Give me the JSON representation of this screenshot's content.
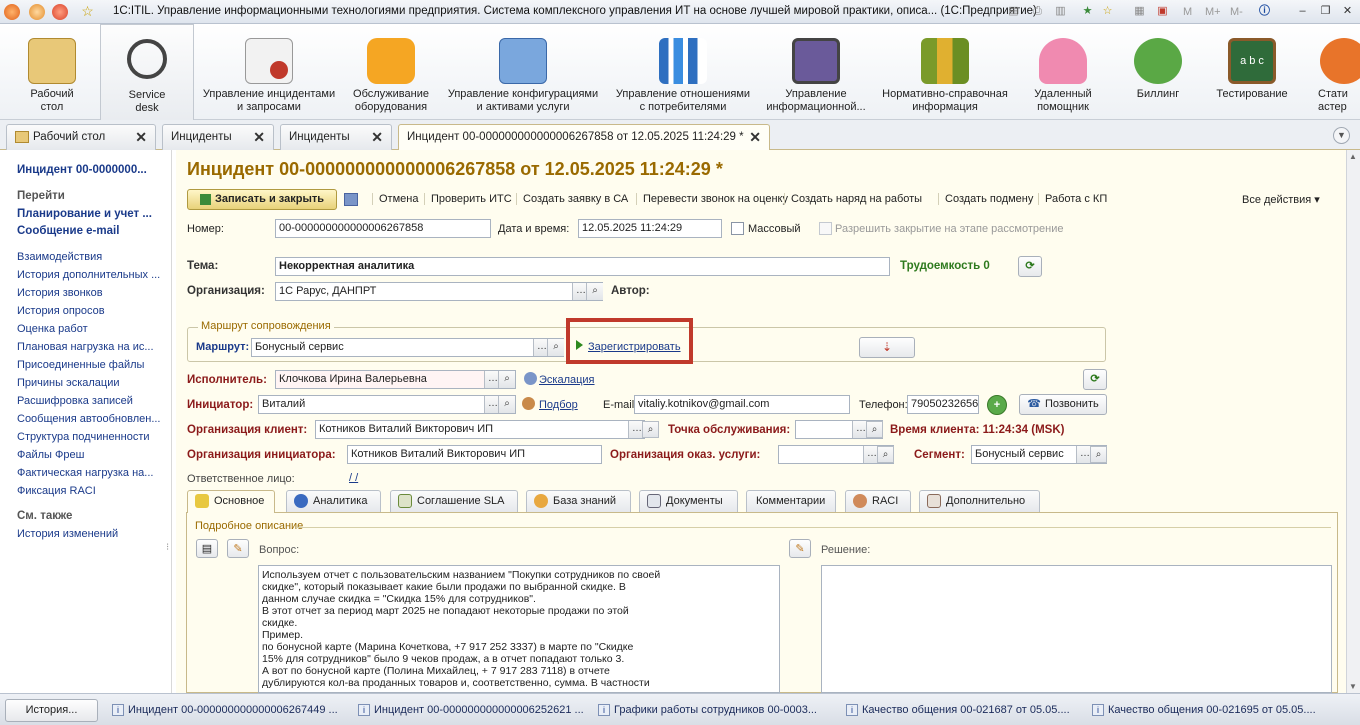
{
  "window": {
    "title": "1С:ITIL. Управление информационными технологиями предприятия. Система комплексного управления ИТ на основе лучшей мировой практики, описа...  (1С:Предприятие)",
    "toolbar_right": [
      "M",
      "M+",
      "M-"
    ]
  },
  "sections": [
    {
      "label": "Рабочий\nстол",
      "icon": "desk-icon",
      "color": "#c9a24a"
    },
    {
      "label": "Service\ndesk",
      "icon": "headset-icon",
      "color": "#333333"
    },
    {
      "label": "Управление инцидентами\nи запросами",
      "icon": "incident-doc-icon",
      "color": "#c0392b"
    },
    {
      "label": "Обслуживание\nоборудования",
      "icon": "truck-icon",
      "color": "#f39c12"
    },
    {
      "label": "Управление конфигурациями\nи активами услуги",
      "icon": "config-icon",
      "color": "#3a78c9"
    },
    {
      "label": "Управление отношениями\nс потребителями",
      "icon": "chart-bars-icon",
      "color": "#2e6fc0"
    },
    {
      "label": "Управление\nинформационной...",
      "icon": "lock-monitor-icon",
      "color": "#6a5a9a"
    },
    {
      "label": "Нормативно-справочная\nинформация",
      "icon": "binders-icon",
      "color": "#6b8e23"
    },
    {
      "label": "Удаленный\nпомощник",
      "icon": "patrick-icon",
      "color": "#e87aa0"
    },
    {
      "label": "Биллинг",
      "icon": "plankton-icon",
      "color": "#4f9a3a"
    },
    {
      "label": "Тестирование",
      "icon": "blackboard-icon",
      "color": "#2f6b3a"
    },
    {
      "label": "Стати\nастер",
      "icon": "stats-icon",
      "color": "#e8742a"
    }
  ],
  "open_tabs": [
    {
      "label": "Рабочий стол"
    },
    {
      "label": "Инциденты"
    },
    {
      "label": "Инциденты"
    },
    {
      "label": "Инцидент 00-000000000000006267858 от 12.05.2025 11:24:29 *"
    }
  ],
  "left_panel": {
    "header": "Инцидент 00-0000000...",
    "go_label": "Перейти",
    "bold_links": [
      "Планирование и учет ...",
      "Сообщение e-mail"
    ],
    "links": [
      "Взаимодействия",
      "История дополнительных ...",
      "История звонков",
      "История опросов",
      "Оценка работ",
      "Плановая нагрузка на ис...",
      "Присоединенные файлы",
      "Причины эскалации",
      "Расшифровка записей",
      "Сообщения автообновлен...",
      "Структура подчиненности",
      "Файлы Фреш",
      "Фактическая нагрузка на...",
      "Фиксация RACI"
    ],
    "see_also_label": "См. также",
    "see_also": [
      "История изменений"
    ]
  },
  "form": {
    "title": "Инцидент 00-000000000000006267858 от 12.05.2025 11:24:29 *",
    "toolbar": {
      "save_close": "Записать и закрыть",
      "items": [
        "Отмена",
        "Проверить ИТС",
        "Создать заявку в СА",
        "Перевести звонок на оценку",
        "Создать наряд на работы",
        "Создать подмену",
        "Работа с КП"
      ],
      "all_actions": "Все действия"
    },
    "number_label": "Номер:",
    "number": "00-000000000000006267858",
    "datetime_label": "Дата и время:",
    "datetime": "12.05.2025 11:24:29",
    "mass_label": "Массовый",
    "allow_close_label": "Разрешить закрытие на этапе рассмотрение",
    "subject_label": "Тема:",
    "subject": "Некорректная аналитика",
    "labor_label": "Трудоемкость 0",
    "org_label": "Организация:",
    "org": "1С Рарус, ДАНПРТ",
    "author_label": "Автор:",
    "route_group": "Маршрут сопровождения",
    "route_label": "Маршрут:",
    "route": "Бонусный сервис",
    "register_link": "Зарегистрировать",
    "executor_label": "Исполнитель:",
    "executor": "Клочкова Ирина Валерьевна",
    "escalation_link": "Эскалация",
    "initiator_label": "Инициатор:",
    "initiator": "Виталий",
    "select_link": "Подбор",
    "email_label": "E-mail:",
    "email": "vitaliy.kotnikov@gmail.com",
    "phone_label": "Телефон:",
    "phone": "79050232656",
    "call_button": "Позвонить",
    "client_org_label": "Организация клиент:",
    "client_org": "Котников Виталий Викторович ИП",
    "service_point_label": "Точка обслуживания:",
    "client_time_label": "Время клиента:  11:24:34 (MSK)",
    "init_org_label": "Организация инициатора:",
    "init_org": "Котников Виталий Викторович ИП",
    "provider_org_label": "Организация оказ. услуги:",
    "segment_label": "Сегмент:",
    "segment": "Бонусный сервис",
    "responsible_label": "Ответственное лицо:",
    "responsible": "/ /",
    "content_tabs": [
      "Основное",
      "Аналитика",
      "Соглашение SLA",
      "База знаний",
      "Документы",
      "Комментарии",
      "RACI",
      "Дополнительно"
    ],
    "details_group": "Подробное описание",
    "question_label": "Вопрос:",
    "solution_label": "Решение:",
    "question_text": "Используем отчет с пользовательским названием \"Покупки сотрудников по своей\nскидке\", который показывает какие были продажи по выбранной скидке. В\nданном случае скидка = \"Скидка 15% для сотрудников\".\nВ этот отчет за период март 2025 не попадают некоторые продажи по этой\nскидке.\nПример.\nпо бонусной карте (Марина Кочеткова, +7 917 252 3337) в марте по \"Скидке\n15% для сотрудников\" было 9 чеков продаж, а в отчет попадают только 3.\nА вот по бонусной карте (Полина Михайлец, + 7 917 283 7118) в отчете\nдублируются кол-ва проданных товаров и, соответственно, сумма. В частности"
  },
  "statusbar": {
    "history": "История...",
    "tasks": [
      "Инцидент 00-000000000000006267449 ...",
      "Инцидент 00-000000000000006252621 ...",
      "Графики работы сотрудников 00-0003...",
      "Качество общения 00-021687 от 05.05....",
      "Качество общения 00-021695 от 05.05...."
    ]
  },
  "colors": {
    "highlight_box": "#c0392b",
    "title": "#9a6a00",
    "link": "#1a3a8a"
  }
}
